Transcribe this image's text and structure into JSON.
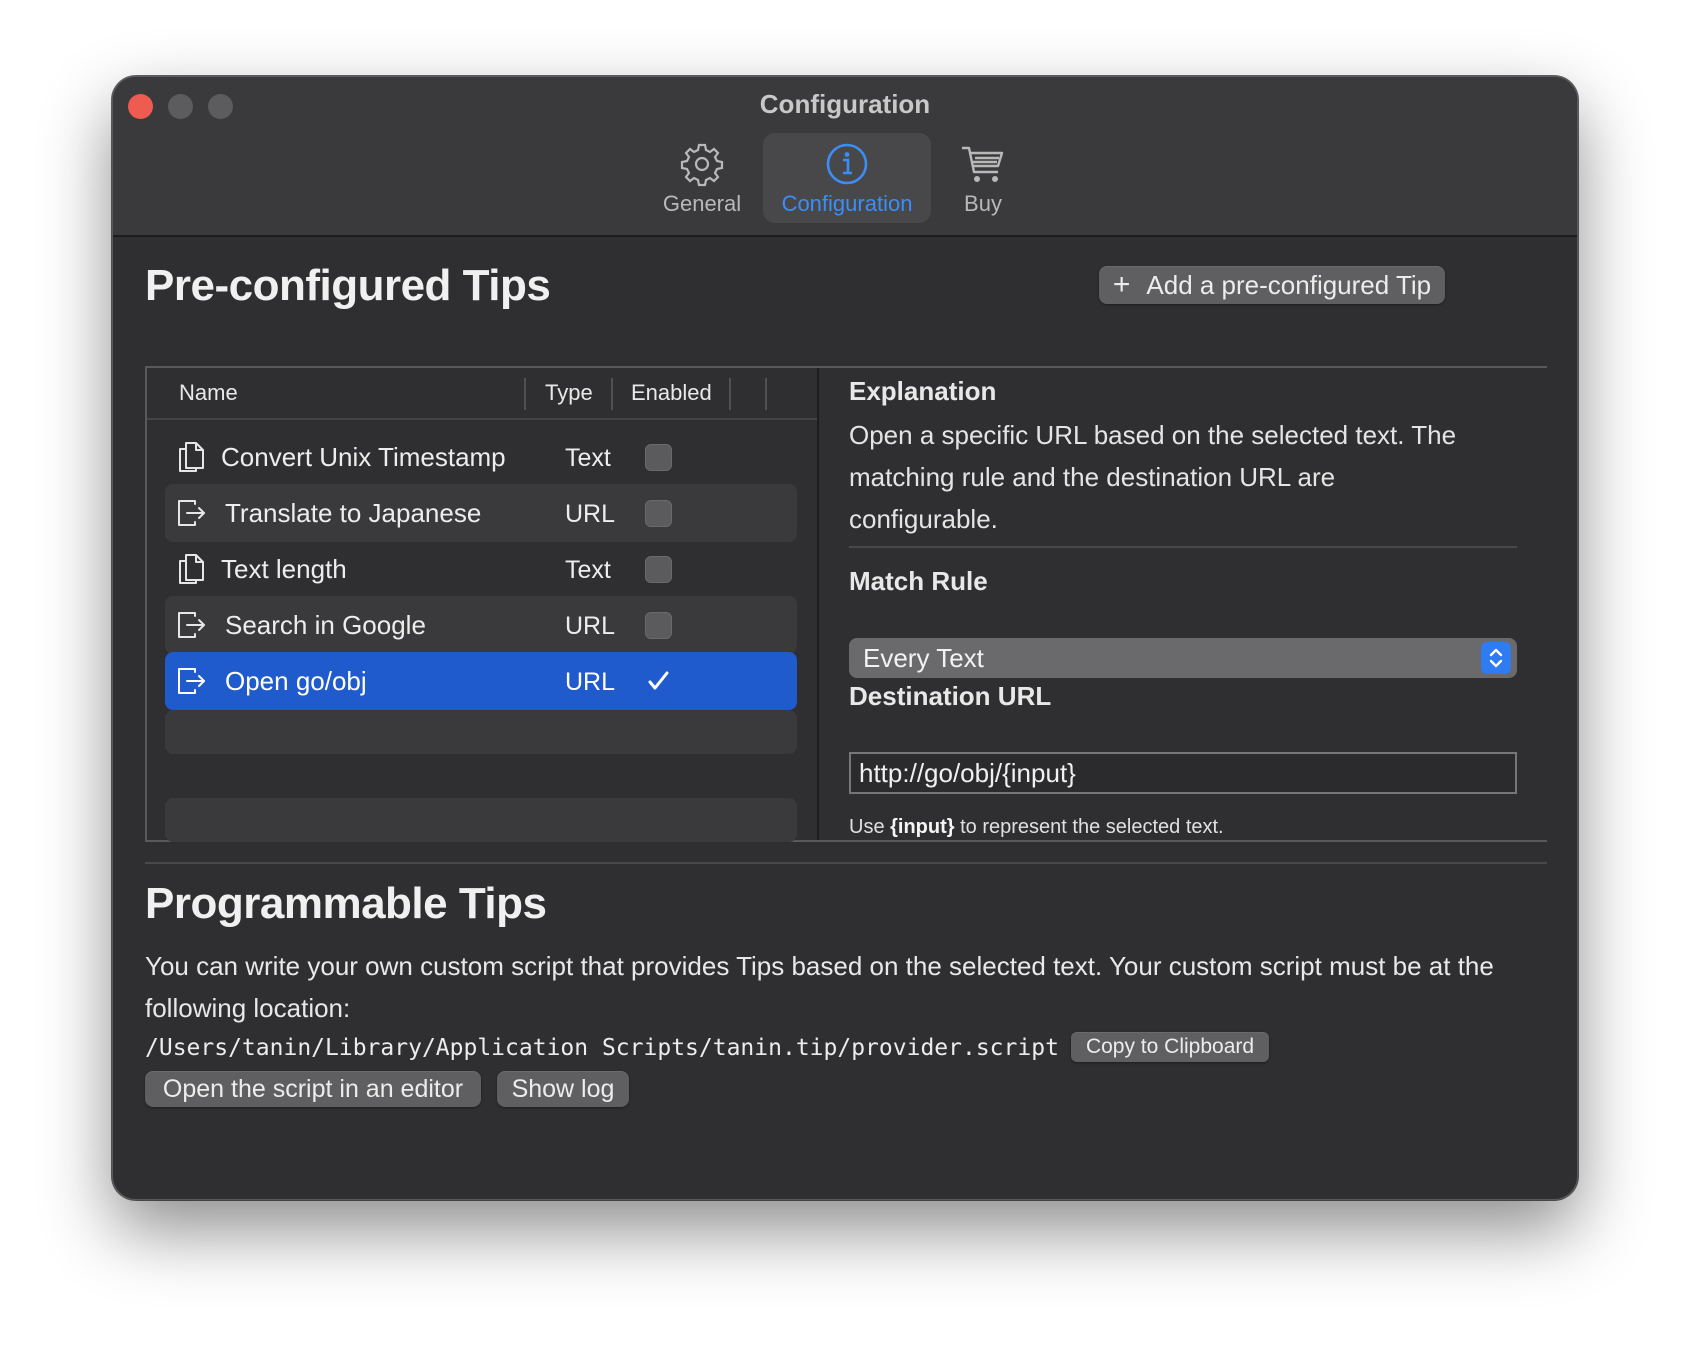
{
  "window": {
    "title": "Configuration"
  },
  "tabs": [
    {
      "label": "General",
      "icon": "gear-icon"
    },
    {
      "label": "Configuration",
      "icon": "info-icon",
      "active": true
    },
    {
      "label": "Buy",
      "icon": "cart-icon"
    }
  ],
  "preconfigured": {
    "title": "Pre-configured Tips",
    "add_button": "Add a pre-configured Tip",
    "columns": {
      "name": "Name",
      "type": "Type",
      "enabled": "Enabled"
    },
    "rows": [
      {
        "name": "Convert Unix Timestamp",
        "type": "Text",
        "enabled": false,
        "icon": "copy-doc-icon"
      },
      {
        "name": "Translate to Japanese",
        "type": "URL",
        "enabled": false,
        "icon": "open-link-icon"
      },
      {
        "name": "Text length",
        "type": "Text",
        "enabled": false,
        "icon": "copy-doc-icon"
      },
      {
        "name": "Search in Google",
        "type": "URL",
        "enabled": false,
        "icon": "open-link-icon"
      },
      {
        "name": "Open go/obj",
        "type": "URL",
        "enabled": true,
        "icon": "open-link-icon",
        "selected": true
      }
    ]
  },
  "detail": {
    "explanation_label": "Explanation",
    "explanation_text": "Open a specific URL based on the selected text. The matching rule and the destination URL are configurable.",
    "match_rule_label": "Match Rule",
    "match_rule_value": "Every Text",
    "destination_label": "Destination URL",
    "destination_value": "http://go/obj/{input}",
    "hint_prefix": "Use ",
    "hint_token": "{input}",
    "hint_suffix": " to represent the selected text."
  },
  "programmable": {
    "title": "Programmable Tips",
    "description": "You can write your own custom script that provides Tips based on the selected text. Your custom script must be at the following location:",
    "script_path": "/Users/tanin/Library/Application Scripts/tanin.tip/provider.script",
    "copy_button": "Copy to Clipboard",
    "open_editor_button": "Open the script in an editor",
    "show_log_button": "Show log"
  },
  "colors": {
    "accent": "#3b8ef6",
    "selection": "#1f5bcc",
    "close": "#ee5b50"
  }
}
